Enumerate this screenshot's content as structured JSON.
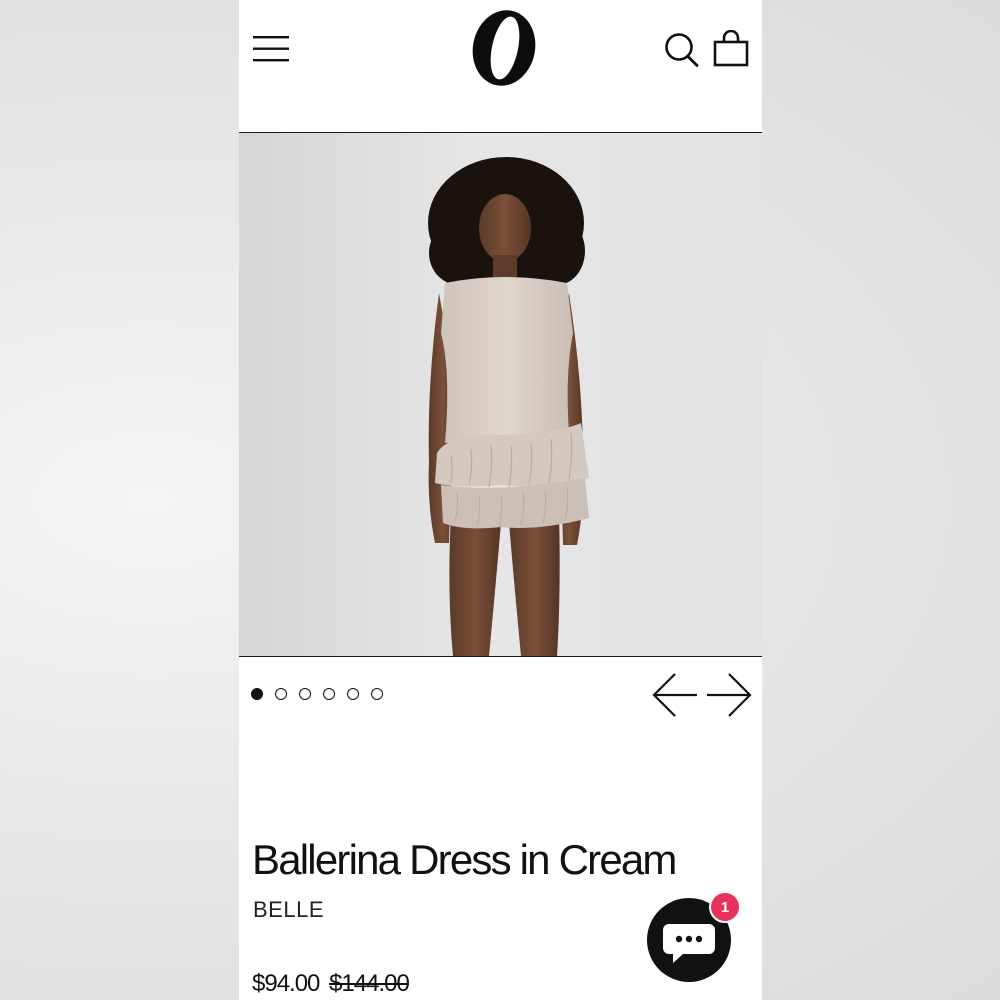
{
  "header": {
    "logo_text": "O",
    "menu_icon": "hamburger-menu-icon",
    "search_icon": "search-icon",
    "cart_icon": "shopping-bag-icon"
  },
  "product": {
    "image_alt": "Model wearing cream ruffled mini dress",
    "title": "Ballerina Dress in Cream",
    "brand": "BELLE",
    "price": "$94.00",
    "compare_at_price": "$144.00"
  },
  "carousel": {
    "slide_count": 6,
    "active_index": 0,
    "prev_icon": "arrow-left-icon",
    "next_icon": "arrow-right-icon"
  },
  "chat": {
    "icon": "chat-bubble-icon",
    "badge_count": "1"
  },
  "colors": {
    "accent_badge": "#e8315b",
    "text": "#111111",
    "dress": "#d9cfc7"
  }
}
